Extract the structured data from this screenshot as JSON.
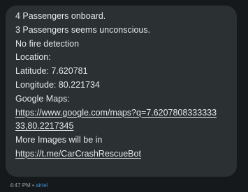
{
  "message": {
    "lines": [
      "4 Passengers onboard.",
      "3 Passengers seems unconscious.",
      "No fire detection",
      "Location:",
      "Latitude: 7.620781",
      "Longitude: 80.221734",
      "Google Maps:"
    ],
    "maps_link_line1": "https://www.google.com/maps?q=7.6207808333333",
    "maps_link_line2": "33,80.2217345",
    "more_images_text": "More Images will be in",
    "bot_link": "https://t.me/CarCrashRescueBot"
  },
  "meta": {
    "time": "4:47 PM",
    "separator": "•",
    "carrier": "airtel"
  },
  "colors": {
    "background": "#16191c",
    "bubble": "#2b3033",
    "text": "#e6e9eb",
    "carrier": "#3f8fd1"
  }
}
